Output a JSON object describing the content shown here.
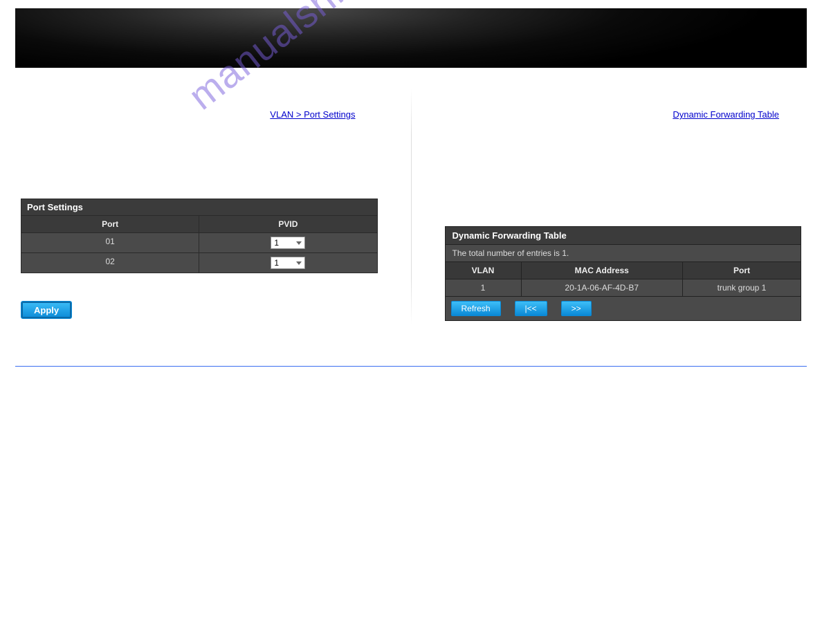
{
  "watermark": "manualshive.com",
  "left": {
    "link_label": "VLAN > Port Settings",
    "table_title": "Port Settings",
    "headers": {
      "port": "Port",
      "pvid": "PVID"
    },
    "rows": [
      {
        "port": "01",
        "pvid": "1"
      },
      {
        "port": "02",
        "pvid": "1"
      }
    ],
    "apply_label": "Apply"
  },
  "right": {
    "link_label": "Dynamic Forwarding Table",
    "table_title": "Dynamic Forwarding Table",
    "entries_text": "The total number of entries is 1.",
    "headers": {
      "vlan": "VLAN",
      "mac": "MAC Address",
      "port": "Port"
    },
    "rows": [
      {
        "vlan": "1",
        "mac": "20-1A-06-AF-4D-B7",
        "port": "trunk group 1"
      }
    ],
    "buttons": {
      "refresh": "Refresh",
      "first": "|<<",
      "next": ">>"
    }
  }
}
